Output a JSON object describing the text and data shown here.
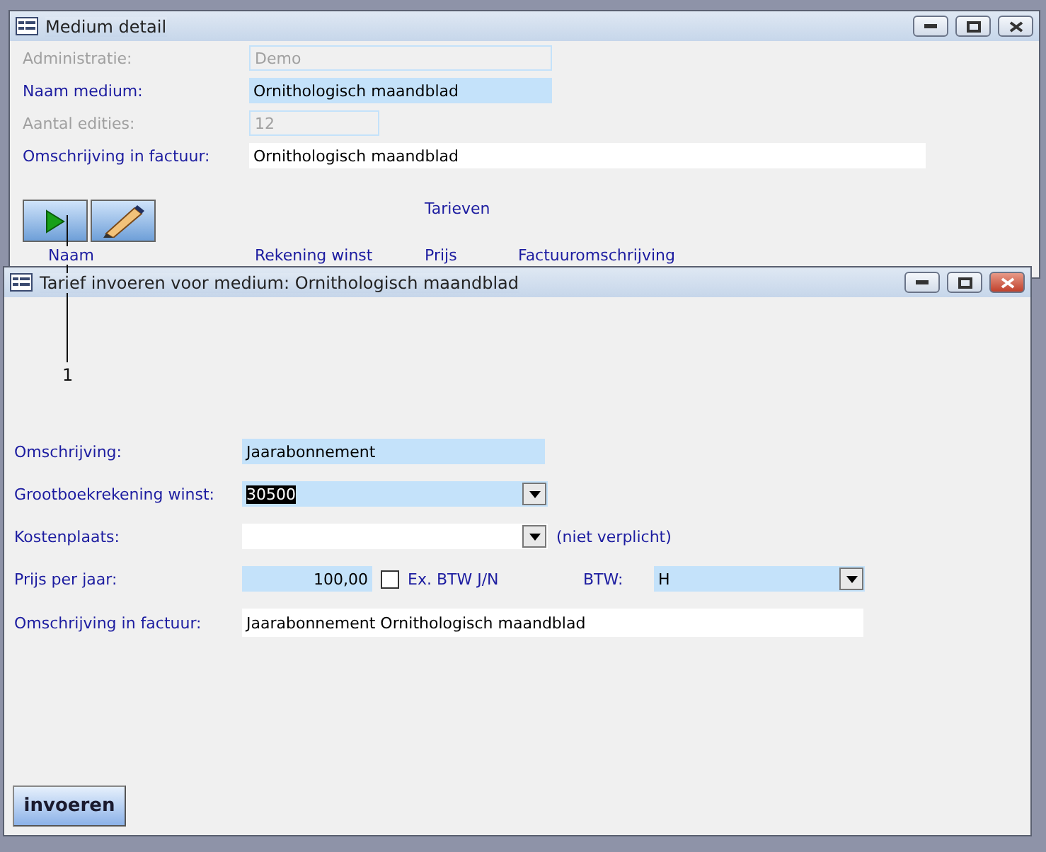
{
  "main_window": {
    "title": "Medium detail",
    "fields": [
      {
        "label": "Administratie:",
        "value": "Demo",
        "disabled": true,
        "highlighted": false
      },
      {
        "label": "Naam medium:",
        "value": "Ornithologisch maandblad",
        "disabled": false,
        "highlighted": true
      },
      {
        "label": "Aantal edities:",
        "value": "12",
        "disabled": true,
        "highlighted": false
      },
      {
        "label": "Omschrijving in factuur:",
        "value": "Ornithologisch maandblad",
        "disabled": false,
        "highlighted": false
      }
    ],
    "tools": [
      {
        "kind": "play"
      },
      {
        "kind": "edit"
      }
    ],
    "list_title": "Tarieven",
    "columns": [
      "Naam",
      "Rekening winst",
      "Prijs",
      "Factuuromschrijving"
    ]
  },
  "callout": "1",
  "dialog": {
    "title": "Tarief invoeren voor medium: Ornithologisch maandblad",
    "fields": [
      {
        "kind": "text",
        "label": "Omschrijving:",
        "value": "Jaarabonnement",
        "highlighted": true
      },
      {
        "kind": "combo",
        "label": "Grootboekrekening winst:",
        "value": "30500",
        "highlighted": true,
        "text_selected": true
      },
      {
        "kind": "combo",
        "label": "Kostenplaats:",
        "highlighted": false,
        "note": "(niet verplicht)"
      },
      {
        "kind": "price",
        "label": "Prijs per jaar:",
        "value": "100,00",
        "highlighted": true,
        "checkbox": {
          "label": "Ex. BTW J/N",
          "checked": false
        },
        "vat": {
          "label": "BTW:",
          "value": "H"
        }
      },
      {
        "kind": "wide",
        "label": "Omschrijving in factuur:",
        "value": "Jaarabonnement Ornithologisch maandblad",
        "highlighted": false
      }
    ],
    "submit": "invoeren"
  }
}
